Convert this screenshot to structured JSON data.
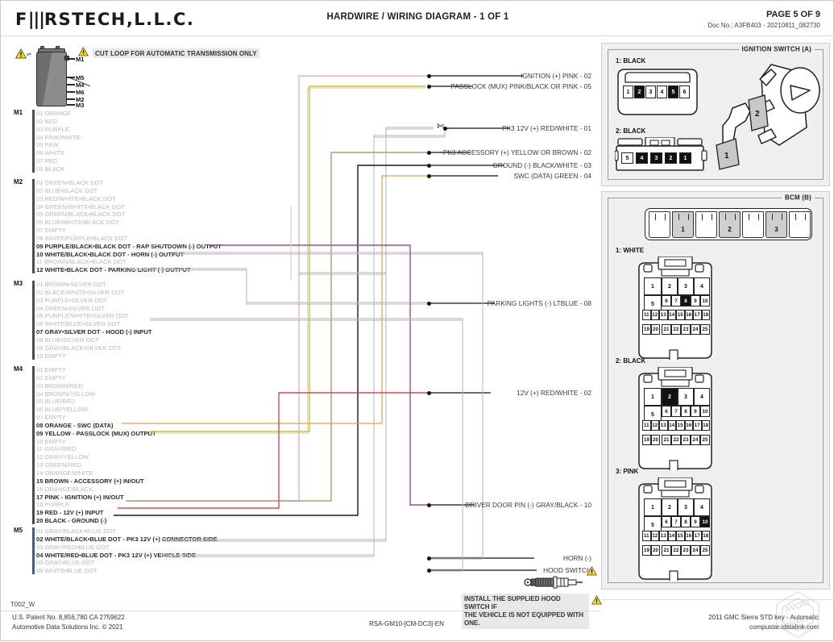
{
  "header": {
    "logo": "FIRSTECH,L.L.C.",
    "title": "HARDWIRE / WIRING DIAGRAM - 1 OF 1",
    "page": "PAGE 5 OF 9",
    "doc": "Doc No.: A3FB403 - 20210811_082730"
  },
  "module": {
    "pins": [
      "M1",
      "M5",
      "M4",
      "M6",
      "M2",
      "M3"
    ],
    "warning_icon": "warning-triangle-icon",
    "cut_note": "CUT LOOP FOR AUTOMATIC TRANSMISSION ONLY"
  },
  "connectors": [
    {
      "tag": "M1",
      "pins": [
        {
          "n": "01",
          "text": "01 ORANGE",
          "active": false
        },
        {
          "n": "02",
          "text": "02 RED",
          "active": false
        },
        {
          "n": "03",
          "text": "03 PURPLE",
          "active": false
        },
        {
          "n": "04",
          "text": "04 PINK/WHITE",
          "active": false
        },
        {
          "n": "05",
          "text": "05 PINK",
          "active": false
        },
        {
          "n": "06",
          "text": "06 WHITE",
          "active": false
        },
        {
          "n": "07",
          "text": "07 RED",
          "active": false
        },
        {
          "n": "08",
          "text": "08 BLACK",
          "active": false
        }
      ]
    },
    {
      "tag": "M2",
      "pins": [
        {
          "n": "01",
          "text": "01 GREEN•BLACK DOT",
          "active": false
        },
        {
          "n": "02",
          "text": "02 BLUE•BLACK DOT",
          "active": false
        },
        {
          "n": "03",
          "text": "03 RED/WHITE•BLACK DOT",
          "active": false
        },
        {
          "n": "04",
          "text": "04 GREEN/WHITE•BLACK DOT",
          "active": false
        },
        {
          "n": "05",
          "text": "05 GREEN/BLACK•BLACK DOT",
          "active": false
        },
        {
          "n": "06",
          "text": "06 BLUE/WHITE•BLACK DOT",
          "active": false
        },
        {
          "n": "07",
          "text": "07 EMPTY",
          "active": false
        },
        {
          "n": "08",
          "text": "08 WHITE/PURPLE•BLACK DOT",
          "active": false
        },
        {
          "n": "09",
          "text": "09 PURPLE/BLACK•BLACK DOT - RAP SHUTDOWN (-) OUTPUT",
          "active": true,
          "color": "#9a4fa6"
        },
        {
          "n": "10",
          "text": "10 WHITE/BLACK•BLACK DOT - HORN (-) OUTPUT",
          "active": true,
          "color": "#b0b0b0"
        },
        {
          "n": "11",
          "text": "11 BROWN/BLACK•BLACK DOT",
          "active": false
        },
        {
          "n": "12",
          "text": "12 WHITE•BLACK DOT - PARKING LIGHT (-) OUTPUT",
          "active": true,
          "color": "#b0b0b0"
        }
      ]
    },
    {
      "tag": "M3",
      "pins": [
        {
          "n": "01",
          "text": "01 BROWN•SILVER DOT",
          "active": false
        },
        {
          "n": "02",
          "text": "02 BLACK/WHITE•SILVER DOT",
          "active": false
        },
        {
          "n": "03",
          "text": "03 PURPLE•SILVER DOT",
          "active": false
        },
        {
          "n": "04",
          "text": "04 GREEN•SILVER DOT",
          "active": false
        },
        {
          "n": "05",
          "text": "05 PURPLE/WHITE•SILVER DOT",
          "active": false
        },
        {
          "n": "06",
          "text": "06 WHITE/BLUE•SILVER DOT",
          "active": false
        },
        {
          "n": "07",
          "text": "07 GRAY•SILVER DOT - HOOD (-) INPUT",
          "active": true,
          "color": "#9e9e9e"
        },
        {
          "n": "08",
          "text": "08 BLUE•SILVER DOT",
          "active": false
        },
        {
          "n": "09",
          "text": "09 GRAY/BLACK•SILVER DOT",
          "active": false
        },
        {
          "n": "10",
          "text": "10 EMPTY",
          "active": false
        }
      ]
    },
    {
      "tag": "M4",
      "pins": [
        {
          "n": "01",
          "text": "01 EMPTY",
          "active": false
        },
        {
          "n": "02",
          "text": "02 EMPTY",
          "active": false
        },
        {
          "n": "03",
          "text": "03 BROWN/RED",
          "active": false
        },
        {
          "n": "04",
          "text": "04 BROWN/YELLOW",
          "active": false
        },
        {
          "n": "05",
          "text": "05 BLUE/RED",
          "active": false
        },
        {
          "n": "06",
          "text": "06 BLUE/YELLOW",
          "active": false
        },
        {
          "n": "07",
          "text": "07 EMPTY",
          "active": false
        },
        {
          "n": "08",
          "text": "08 ORANGE - SWC (DATA)",
          "active": true,
          "color": "#e3a04a"
        },
        {
          "n": "09",
          "text": "09 YELLOW - PASSLOCK (MUX) OUTPUT",
          "active": true,
          "color": "#c9c24a"
        },
        {
          "n": "10",
          "text": "10 EMPTY",
          "active": false
        },
        {
          "n": "11",
          "text": "11 GRAY/RED",
          "active": false
        },
        {
          "n": "12",
          "text": "12 GRAY/YELLOW",
          "active": false
        },
        {
          "n": "13",
          "text": "13 GREEN/RED",
          "active": false
        },
        {
          "n": "14",
          "text": "14 ORANGE/WHITE",
          "active": false
        },
        {
          "n": "15",
          "text": "15 BROWN - ACCESSORY (+) IN/OUT",
          "active": true,
          "color": "#a08a62"
        },
        {
          "n": "16",
          "text": "16 ORANGE/BLACK",
          "active": false
        },
        {
          "n": "17",
          "text": "17 PINK - IGNITION (+) IN/OUT",
          "active": true,
          "color": "#ef9ec0"
        },
        {
          "n": "18",
          "text": "18 PURPLE",
          "active": false
        },
        {
          "n": "19",
          "text": "19 RED - 12V (+) INPUT",
          "active": true,
          "color": "#d24b52"
        },
        {
          "n": "20",
          "text": "20 BLACK - GROUND (-)",
          "active": true,
          "color": "#1a1a1a"
        }
      ]
    },
    {
      "tag": "M5",
      "pins": [
        {
          "n": "01",
          "text": "01 GRAY/BLACK•BLUE DOT",
          "active": false
        },
        {
          "n": "02",
          "text": "02 WHITE/BLACK•BLUE DOT - PK3 12V (+) CONNECTOR SIDE",
          "active": true,
          "color": "#b0b0b0"
        },
        {
          "n": "03",
          "text": "03 GRAY/RED•BLUE DOT",
          "active": false
        },
        {
          "n": "04",
          "text": "04 WHITE/RED•BLUE DOT - PK3 12V (+) VEHICLE SIDE",
          "active": true,
          "color": "#b0b0b0"
        },
        {
          "n": "05",
          "text": "05 GRAY•BLUE DOT",
          "active": false
        },
        {
          "n": "06",
          "text": "06 WHITE•BLUE DOT",
          "active": false
        }
      ]
    }
  ],
  "vehicle_labels": [
    {
      "id": "ignition",
      "text": "IGNITION (+) PINK - 02"
    },
    {
      "id": "passlock",
      "text": "PASSLOCK (MUX) PINK/BLACK OR PINK - 05"
    },
    {
      "id": "pk3-12v",
      "text": "PK3 12V (+) RED/WHITE - 01"
    },
    {
      "id": "pk3-accessory",
      "text": "PK3 ACCESSORY (+) YELLOW OR BROWN - 02"
    },
    {
      "id": "ground",
      "text": "GROUND (-) BLACK/WHITE - 03"
    },
    {
      "id": "swc-data",
      "text": "SWC (DATA) GREEN - 04"
    },
    {
      "id": "parking-lights",
      "text": "PARKING LIGHTS (-) LTBLUE - 08"
    },
    {
      "id": "12v",
      "text": "12V (+) RED/WHITE - 02"
    },
    {
      "id": "driver-door-pin",
      "text": "DRIVER DOOR PIN (-) GRAY/BLACK - 10"
    },
    {
      "id": "horn",
      "text": "HORN (-)"
    },
    {
      "id": "hood-switch",
      "text": "HOOD SWITCH"
    }
  ],
  "hood_note": {
    "line1": "INSTALL THE SUPPLIED HOOD SWITCH IF",
    "line2": "THE VEHICLE IS NOT EQUIPPED WITH ONE."
  },
  "ignition_switch": {
    "title": "IGNITION SWITCH (A)",
    "c1_label": "1: BLACK",
    "c1_pins": [
      "1",
      "2",
      "3",
      "4",
      "5",
      "6"
    ],
    "c1_highlight": [
      "2",
      "5"
    ],
    "c2_label": "2: BLACK",
    "c2_pins": [
      "5",
      "4",
      "3",
      "2",
      "1"
    ],
    "c2_highlight": [
      "4",
      "3",
      "2",
      "1"
    ],
    "callouts": [
      "1",
      "2"
    ]
  },
  "bcm": {
    "title": "BCM (B)",
    "strip_slots": [
      "",
      "1",
      "",
      "2",
      "",
      "3",
      ""
    ],
    "strip_shaded": [
      false,
      true,
      false,
      true,
      false,
      true,
      false
    ],
    "c1_label": "1: WHITE",
    "c1_highlight": "8",
    "c2_label": "2: BLACK",
    "c2_highlight": "2",
    "c3_label": "3: PINK",
    "c3_highlight": "10",
    "grid": {
      "row_top": [
        "1",
        "2",
        "3",
        "4"
      ],
      "row_mid_left": "5",
      "row_mid": [
        "6",
        "7",
        "8",
        "9",
        "10"
      ],
      "row3": [
        "11",
        "12",
        "13",
        "14",
        "15",
        "16",
        "17",
        "18"
      ],
      "row4": [
        "19",
        "20",
        "21",
        "22",
        "23",
        "24",
        "25"
      ]
    }
  },
  "footer": {
    "code": "T002_W",
    "patent": "U.S. Patent No. 8,856,780 CA 2759622",
    "company": "Automotive Data Solutions Inc. © 2021",
    "center": "RSA-GM10-[CM-DC3]-EN",
    "vehicle": "2011 GMC Sierra STD key - Automatic",
    "site": "compustar.idatalink.com"
  },
  "colors": {
    "pink": "#ef9ec0",
    "yellow": "#c9c24a",
    "orange": "#e3a04a",
    "brown": "#a08a62",
    "red": "#d24b52",
    "purple": "#9a4fa6",
    "gray": "#a8a8a8",
    "black": "#1a1a1a",
    "warning": "#f2dd3a"
  }
}
